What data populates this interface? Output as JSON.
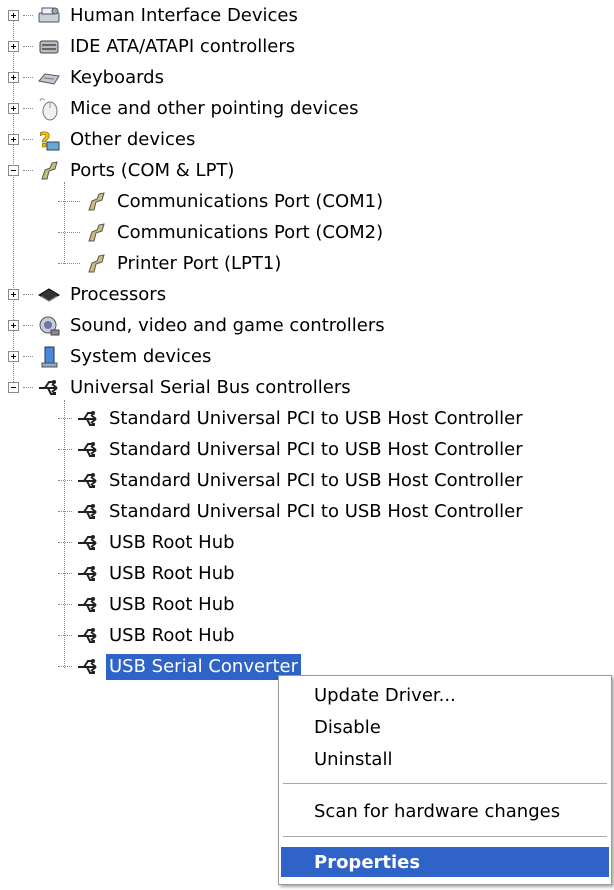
{
  "tree": {
    "top_items": [
      {
        "label": "Human Interface Devices",
        "icon": "hid-icon",
        "state": "collapsed"
      },
      {
        "label": "IDE ATA/ATAPI controllers",
        "icon": "ide-controller-icon",
        "state": "collapsed"
      },
      {
        "label": "Keyboards",
        "icon": "keyboard-icon",
        "state": "collapsed"
      },
      {
        "label": "Mice and other pointing devices",
        "icon": "mouse-icon",
        "state": "collapsed"
      },
      {
        "label": "Other devices",
        "icon": "question-mark-icon",
        "state": "collapsed"
      },
      {
        "label": "Ports (COM & LPT)",
        "icon": "port-icon",
        "state": "expanded",
        "children": [
          {
            "label": "Communications Port (COM1)",
            "icon": "port-icon"
          },
          {
            "label": "Communications Port (COM2)",
            "icon": "port-icon"
          },
          {
            "label": "Printer Port (LPT1)",
            "icon": "port-icon"
          }
        ]
      },
      {
        "label": "Processors",
        "icon": "processor-icon",
        "state": "collapsed"
      },
      {
        "label": "Sound, video and game controllers",
        "icon": "speaker-icon",
        "state": "collapsed"
      },
      {
        "label": "System devices",
        "icon": "computer-icon",
        "state": "collapsed"
      },
      {
        "label": "Universal Serial Bus controllers",
        "icon": "usb-icon",
        "state": "expanded",
        "children": [
          {
            "label": "Standard Universal PCI to USB Host Controller",
            "icon": "usb-icon"
          },
          {
            "label": "Standard Universal PCI to USB Host Controller",
            "icon": "usb-icon"
          },
          {
            "label": "Standard Universal PCI to USB Host Controller",
            "icon": "usb-icon"
          },
          {
            "label": "Standard Universal PCI to USB Host Controller",
            "icon": "usb-icon"
          },
          {
            "label": "USB Root Hub",
            "icon": "usb-icon"
          },
          {
            "label": "USB Root Hub",
            "icon": "usb-icon"
          },
          {
            "label": "USB Root Hub",
            "icon": "usb-icon"
          },
          {
            "label": "USB Root Hub",
            "icon": "usb-icon"
          },
          {
            "label": "USB Serial Converter",
            "icon": "usb-icon",
            "selected": true
          }
        ]
      }
    ]
  },
  "context_menu": {
    "items": [
      {
        "label": "Update Driver..."
      },
      {
        "label": "Disable"
      },
      {
        "label": "Uninstall"
      },
      {
        "label": "Scan for hardware changes"
      },
      {
        "label": "Properties",
        "highlighted": true
      }
    ]
  },
  "colors": {
    "selection": "#2f63c8",
    "selection_text": "#ffffff",
    "background": "#ffffff"
  }
}
